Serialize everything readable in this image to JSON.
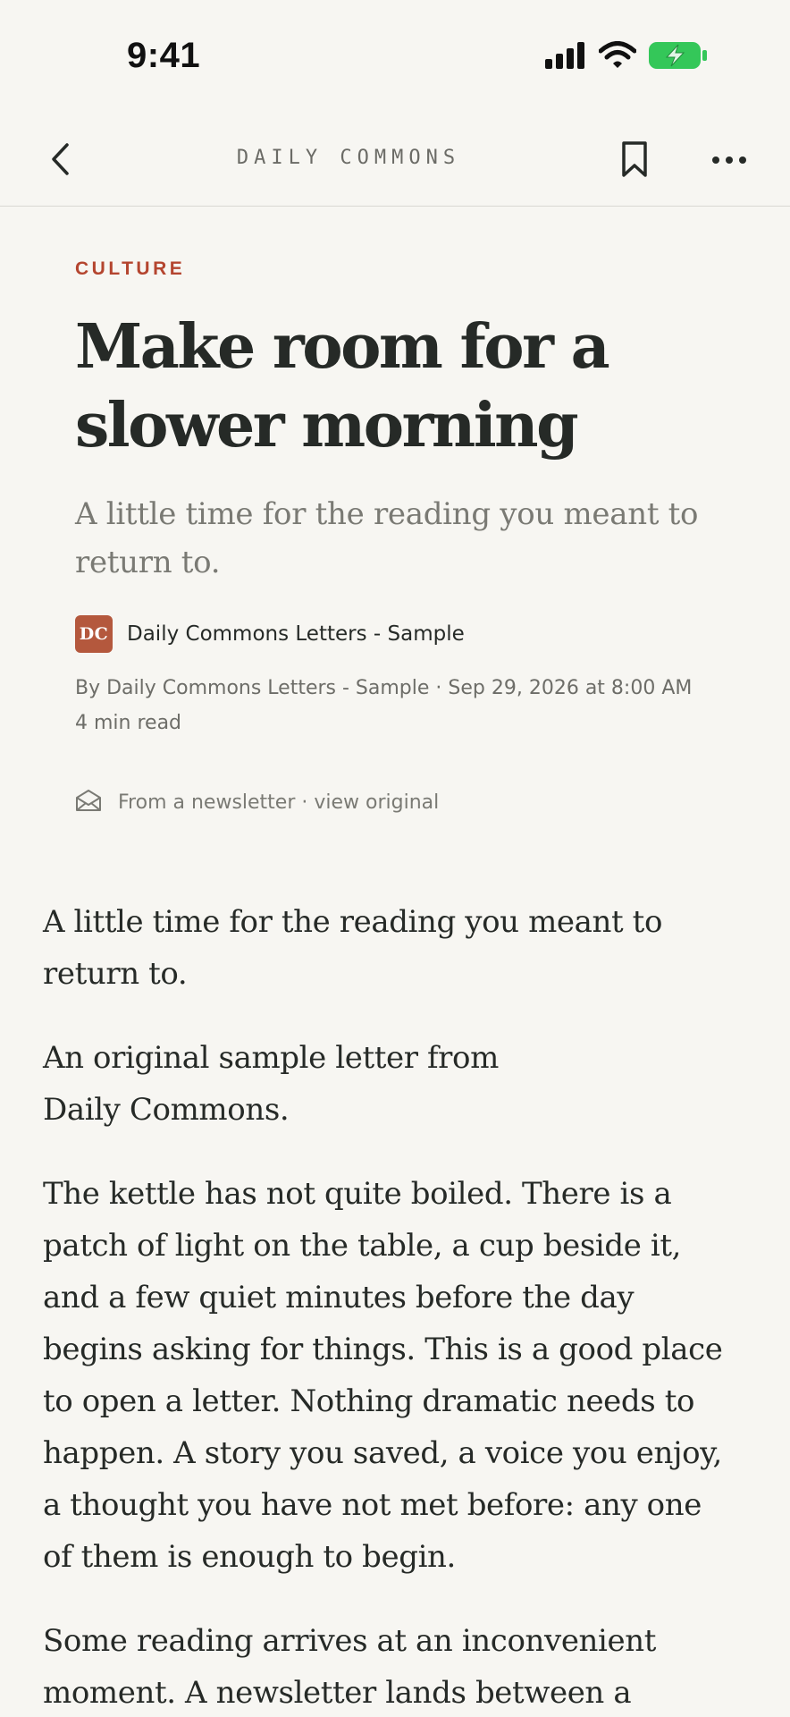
{
  "status_bar": {
    "time": "9:41",
    "icons": [
      "cellular-signal-icon",
      "wifi-icon",
      "battery-charging-icon"
    ],
    "battery_color": "#34c759"
  },
  "nav": {
    "title": "DAILY COMMONS",
    "icons": [
      "chevron-left-icon",
      "bookmark-icon",
      "more-horizontal-icon"
    ]
  },
  "article": {
    "section": "CULTURE",
    "headline_lines": [
      "Make room for a",
      "slower morning"
    ],
    "dek_lines": [
      "A little time for the reading you meant to",
      "return to."
    ],
    "publication": {
      "avatar_initials": "DC",
      "name": "Daily Commons Letters - Sample"
    },
    "meta_line": "By Daily Commons Letters - Sample · Sep 29, 2026 at 8:00 AM",
    "read_time": "4 min read",
    "newsletter_note": "From a newsletter · view original",
    "paragraphs": [
      [
        "A little time for the reading you meant to",
        "return to."
      ],
      [
        "An original sample letter from",
        "Daily Commons."
      ],
      [
        "The kettle has not quite boiled. There is a",
        "patch of light on the table, a cup beside it,",
        "and a few quiet minutes before the day",
        "begins asking for things. This is a good place",
        "to open a letter. Nothing dramatic needs to",
        "happen. A story you saved, a voice you enjoy,",
        "a thought you have not met before: any one",
        "of them is enough to begin."
      ],
      [
        "Some reading arrives at an inconvenient",
        "moment. A newsletter lands between a"
      ]
    ]
  },
  "colors": {
    "background": "#f7f6f2",
    "accent": "#b4452f",
    "avatar": "#b4583d",
    "text": "#262a27",
    "muted": "#7a7a74"
  }
}
